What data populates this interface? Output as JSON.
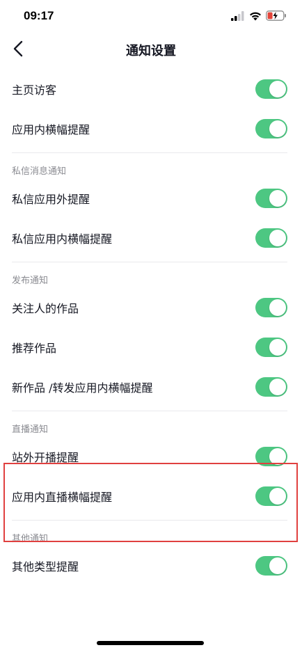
{
  "status_bar": {
    "time": "09:17",
    "icons": [
      "signal-icon",
      "wifi-icon",
      "battery-charging-icon"
    ]
  },
  "nav": {
    "title": "通知设置",
    "back_icon": "chevron-left-icon"
  },
  "colors": {
    "toggle_on": "#4dc782",
    "highlight_border": "#e0403f",
    "section_text": "#8a8b91"
  },
  "sections": [
    {
      "header": "",
      "items": [
        {
          "label": "主页访客",
          "enabled": true
        },
        {
          "label": "应用内横幅提醒",
          "enabled": true
        }
      ]
    },
    {
      "header": "私信消息通知",
      "items": [
        {
          "label": "私信应用外提醒",
          "enabled": true
        },
        {
          "label": "私信应用内横幅提醒",
          "enabled": true
        }
      ]
    },
    {
      "header": "发布通知",
      "items": [
        {
          "label": "关注人的作品",
          "enabled": true
        },
        {
          "label": "推荐作品",
          "enabled": true
        },
        {
          "label": "新作品 /转发应用内横幅提醒",
          "enabled": true
        }
      ]
    },
    {
      "header": "直播通知",
      "items": [
        {
          "label": "站外开播提醒",
          "enabled": true
        },
        {
          "label": "应用内直播横幅提醒",
          "enabled": true
        }
      ]
    },
    {
      "header": "其他通知",
      "items": [
        {
          "label": "其他类型提醒",
          "enabled": true
        }
      ]
    }
  ]
}
